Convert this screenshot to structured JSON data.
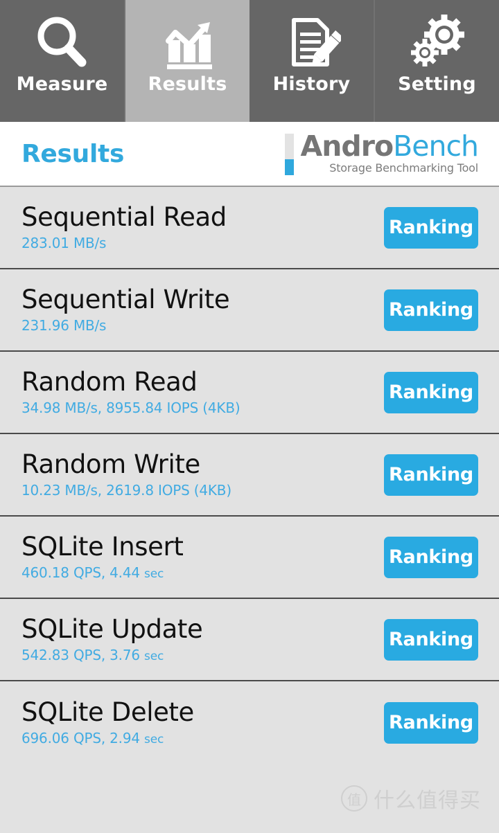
{
  "nav": {
    "tabs": [
      {
        "label": "Measure",
        "icon": "magnifier-icon",
        "active": false
      },
      {
        "label": "Results",
        "icon": "bar-chart-trend-icon",
        "active": true
      },
      {
        "label": "History",
        "icon": "document-pencil-icon",
        "active": false
      },
      {
        "label": "Setting",
        "icon": "gears-icon",
        "active": false
      }
    ]
  },
  "header": {
    "page_title": "Results",
    "logo": {
      "name_part1": "Andro",
      "name_part2": "Bench",
      "tagline": "Storage Benchmarking Tool"
    }
  },
  "results": {
    "ranking_label": "Ranking",
    "rows": [
      {
        "title": "Sequential Read",
        "value": "283.01 MB/s",
        "unit_suffix": ""
      },
      {
        "title": "Sequential Write",
        "value": "231.96 MB/s",
        "unit_suffix": ""
      },
      {
        "title": "Random Read",
        "value": "34.98 MB/s, 8955.84 IOPS (4KB)",
        "unit_suffix": ""
      },
      {
        "title": "Random Write",
        "value": "10.23 MB/s, 2619.8 IOPS (4KB)",
        "unit_suffix": ""
      },
      {
        "title": "SQLite Insert",
        "value": "460.18 QPS, 4.44 ",
        "unit_suffix": "sec"
      },
      {
        "title": "SQLite Update",
        "value": "542.83 QPS, 3.76 ",
        "unit_suffix": "sec"
      },
      {
        "title": "SQLite Delete",
        "value": "696.06 QPS, 2.94 ",
        "unit_suffix": "sec"
      }
    ]
  },
  "footer": {
    "watermark_mark": "值",
    "watermark_text": "什么值得买"
  },
  "colors": {
    "accent_blue": "#29aae1",
    "title_blue": "#32a9dd",
    "value_blue": "#41abe2",
    "nav_bg": "#666666",
    "nav_active_bg": "#b4b4b4",
    "row_bg": "#e2e2e2",
    "row_divider": "#4a4a4a"
  }
}
